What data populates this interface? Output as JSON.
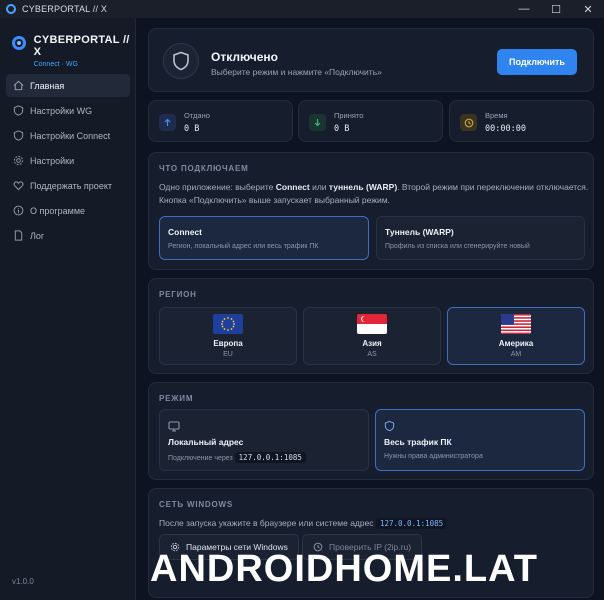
{
  "window": {
    "title": "CYBERPORTAL // X",
    "minimize": "—",
    "maximize": "☐",
    "close": "✕"
  },
  "sidebar": {
    "brand_name": "CYBERPORTAL // X",
    "brand_sub": "Connect · WG",
    "items": [
      {
        "label": "Главная",
        "icon": "home-icon",
        "active": true
      },
      {
        "label": "Настройки WG",
        "icon": "shield-icon"
      },
      {
        "label": "Настройки Connect",
        "icon": "shield-icon"
      },
      {
        "label": "Настройки",
        "icon": "gear-icon"
      },
      {
        "label": "Поддержать проект",
        "icon": "heart-icon"
      },
      {
        "label": "О программе",
        "icon": "info-icon"
      },
      {
        "label": "Лог",
        "icon": "file-icon"
      }
    ],
    "version": "v1.0.0"
  },
  "status": {
    "title": "Отключено",
    "subtitle": "Выберите режим и нажмите «Подключить»",
    "button": "Подключить"
  },
  "stats": [
    {
      "label": "Отдано",
      "value": "0 B",
      "icon": "arrow-up-icon",
      "color": "#3a6fd8"
    },
    {
      "label": "Принято",
      "value": "0 B",
      "icon": "arrow-down-icon",
      "color": "#3fb27f"
    },
    {
      "label": "Время",
      "value": "00:00:00",
      "icon": "clock-icon",
      "color": "#c9a34a"
    }
  ],
  "what": {
    "title": "ЧТО ПОДКЛЮЧАЕМ",
    "text_a": "Одно приложение: выберите ",
    "text_b": "Connect",
    "text_c": " или ",
    "text_d": "туннель (WARP)",
    "text_e": ". Второй режим при переключении отключается.",
    "text_f": "Кнопка «Подключить» выше запускает выбранный режим.",
    "options": [
      {
        "title": "Connect",
        "sub": "Регион, локальный адрес или весь трафик ПК",
        "selected": true
      },
      {
        "title": "Туннель (WARP)",
        "sub": "Профиль из списка или сгенерируйте новый",
        "selected": false
      }
    ]
  },
  "region": {
    "title": "РЕГИОН",
    "items": [
      {
        "name": "Европа",
        "code": "EU",
        "flag": "eu-flag-icon",
        "selected": false
      },
      {
        "name": "Азия",
        "code": "AS",
        "flag": "singapore-flag-icon",
        "selected": false
      },
      {
        "name": "Америка",
        "code": "AM",
        "flag": "usa-flag-icon",
        "selected": true
      }
    ]
  },
  "mode": {
    "title": "РЕЖИМ",
    "options": [
      {
        "title": "Локальный адрес",
        "sub": "Подключение через",
        "addr": "127.0.0.1:1085",
        "icon": "monitor-icon",
        "selected": false
      },
      {
        "title": "Весь трафик ПК",
        "sub": "Нужны права администратора",
        "icon": "shield-icon",
        "selected": true
      }
    ]
  },
  "network": {
    "title": "СЕТЬ WINDOWS",
    "text": "После запуска укажите в браузере или системе адрес",
    "addr": "127.0.0.1:1085",
    "btn_settings": "Параметры сети Windows",
    "btn_check": "Проверить IP (2ip.ru)"
  },
  "watermark": "ANDROIDHOME.LAT"
}
